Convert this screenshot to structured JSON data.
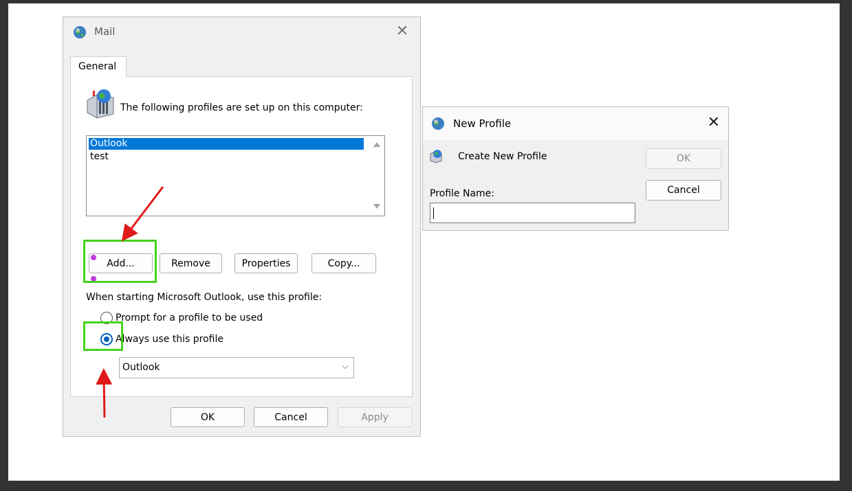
{
  "mail_dialog": {
    "title": "Mail",
    "title_icon": "mail-globe-icon",
    "close_icon": "close-icon",
    "tab_label": "General",
    "heading": "The following profiles are set up on this computer:",
    "profiles": [
      "Outlook",
      "test"
    ],
    "selected_profile": "Outlook",
    "buttons": {
      "add": "Add...",
      "remove": "Remove",
      "properties": "Properties",
      "copy": "Copy..."
    },
    "startup_label": "When starting Microsoft Outlook, use this profile:",
    "radio_prompt": "Prompt for a profile to be used",
    "radio_always": "Always use this profile",
    "radio_selected": "always",
    "always_profile_value": "Outlook",
    "footer": {
      "ok": "OK",
      "cancel": "Cancel",
      "apply": "Apply"
    }
  },
  "new_profile_dialog": {
    "title": "New Profile",
    "close_icon": "close-icon",
    "subtitle": "Create New Profile",
    "ok": "OK",
    "ok_disabled": true,
    "cancel": "Cancel",
    "profile_name_label": "Profile Name:",
    "profile_name_value": ""
  },
  "annotations": {
    "highlight_color": "#47d11f",
    "arrow_color": "#e01b1b"
  }
}
